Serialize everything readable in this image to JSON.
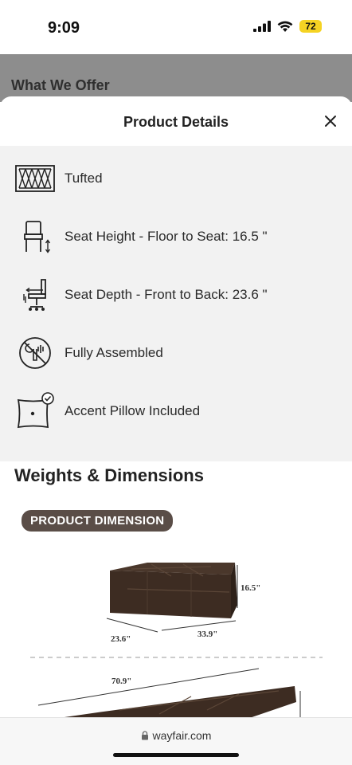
{
  "status_bar": {
    "time": "9:09",
    "battery": "72",
    "icons": [
      "signal-icon",
      "wifi-icon",
      "battery-icon"
    ]
  },
  "background_page": {
    "heading": "What We Offer"
  },
  "sheet": {
    "title": "Product Details",
    "close_icon": "close-icon",
    "details": [
      {
        "icon": "tufted-icon",
        "label": "Tufted"
      },
      {
        "icon": "seat-height-icon",
        "label": "Seat Height - Floor to Seat: 16.5 \""
      },
      {
        "icon": "seat-depth-icon",
        "label": "Seat Depth - Front to Back: 23.6 \""
      },
      {
        "icon": "fully-assembled-icon",
        "label": "Fully Assembled"
      },
      {
        "icon": "accent-pillow-icon",
        "label": "Accent Pillow Included"
      }
    ],
    "weights_title": "Weights & Dimensions",
    "dimension_badge": "PRODUCT DIMENSION",
    "dimensions": {
      "height": "16.5\"",
      "width": "33.9\"",
      "depth": "23.6\"",
      "length": "70.9\""
    }
  },
  "browser": {
    "url": "wayfair.com"
  },
  "colors": {
    "badge": "#5a4d47",
    "sofa": "#3d2c22",
    "dim_overlay": "#8d8d8d",
    "details_bg": "#f2f2f2"
  }
}
